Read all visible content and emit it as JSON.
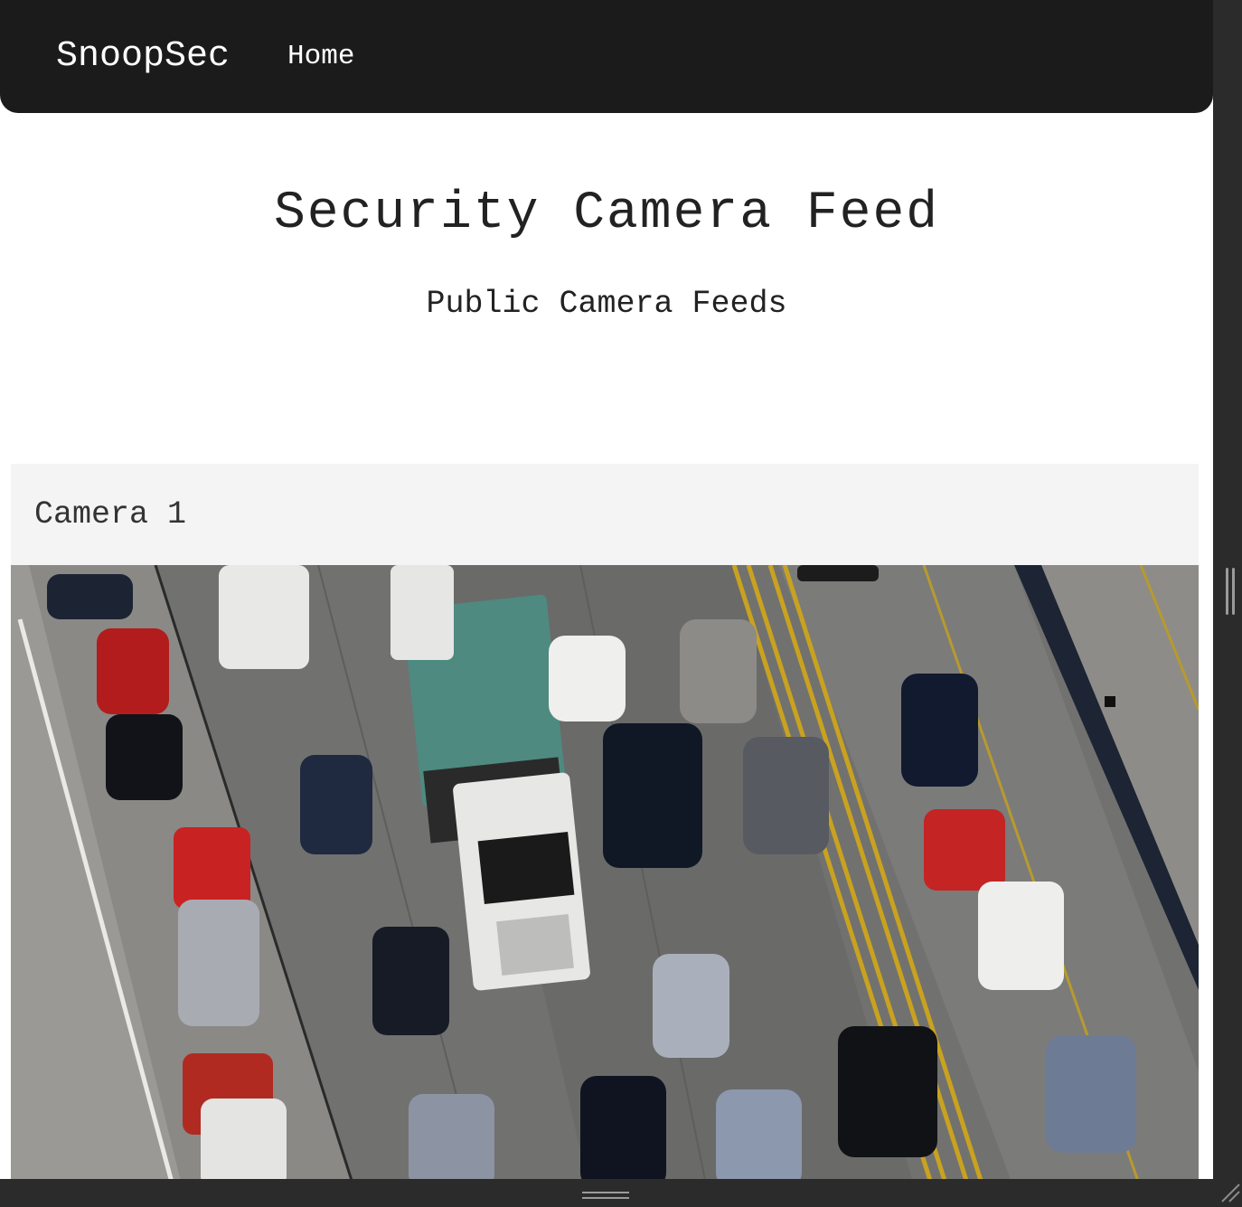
{
  "navbar": {
    "brand": "SnoopSec",
    "links": [
      {
        "label": "Home"
      }
    ]
  },
  "header": {
    "title": "Security Camera Feed",
    "subtitle": "Public Camera Feeds"
  },
  "cameras": [
    {
      "label": "Camera 1",
      "feed": "aerial view of highway traffic"
    }
  ],
  "colors": {
    "navbar_bg": "#1b1b1b",
    "card_bg": "#f4f4f4",
    "page_bg": "#ffffff"
  }
}
